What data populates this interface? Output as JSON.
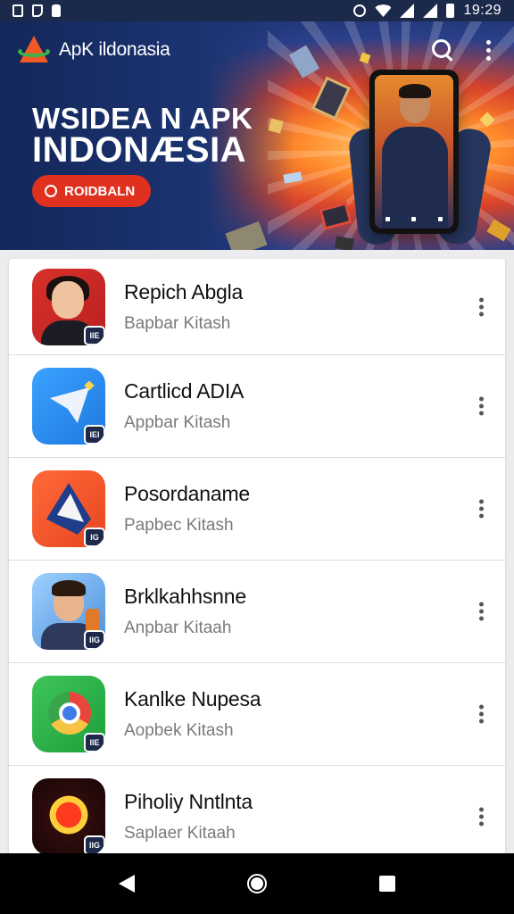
{
  "status_bar": {
    "time": "19:29",
    "left_icons": [
      "notification-icon",
      "notification-icon",
      "battery-saver-icon"
    ],
    "right_icons": [
      "alarm-icon",
      "wifi-icon",
      "signal-icon",
      "signal-icon"
    ]
  },
  "app_bar": {
    "title": "ApK ildonasia",
    "actions": [
      "search-icon",
      "more-vert-icon"
    ]
  },
  "hero": {
    "line1": "WSIDEA N APK",
    "line2": "INDONÆSIA",
    "button_label": "ROIDBALN"
  },
  "apps": [
    {
      "name": "Repich Abgla",
      "subtitle": "Bapbar Kitash",
      "badge": "IIE"
    },
    {
      "name": "Cartlicd ADIA",
      "subtitle": "Appbar Kitash",
      "badge": "IEI"
    },
    {
      "name": "Posordaname",
      "subtitle": "Papbec Kitash",
      "badge": "IG"
    },
    {
      "name": "Brklkahhsnne",
      "subtitle": "Anpbar Kitaah",
      "badge": "IIG"
    },
    {
      "name": "Kanlke Nupesa",
      "subtitle": "Aopbek Kitash",
      "badge": "IIE"
    },
    {
      "name": "Piholiy Nntlnta",
      "subtitle": "Saplaer Kitaah",
      "badge": "IIG"
    }
  ],
  "nav_bar": [
    "back-icon",
    "home-icon",
    "recents-icon"
  ],
  "colors": {
    "status_bar": "#1b2a4a",
    "hero_button": "#e0301e",
    "list_background": "#ffffff"
  }
}
